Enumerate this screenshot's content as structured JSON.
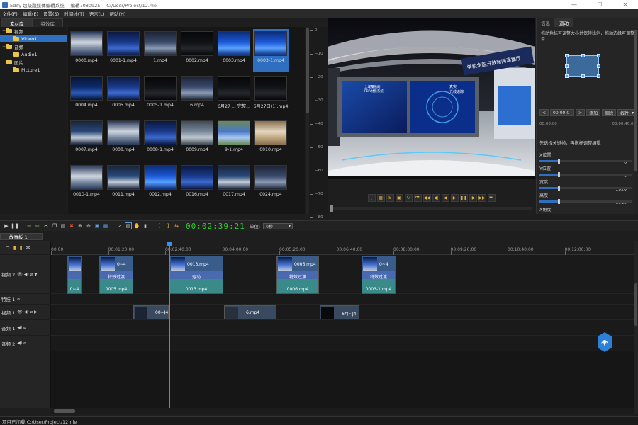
{
  "window": {
    "title": "Edify 超级融媒体编辑系统 -- 编辑7080925 -- C:/User/Project/12.nle"
  },
  "menu": [
    "文件(F)",
    "编辑(E)",
    "设置(S)",
    "时间线(T)",
    "语言(L)",
    "帮助(H)"
  ],
  "left_tabs": {
    "active": "素材库",
    "other": "特效库"
  },
  "tree": [
    {
      "label": "视频",
      "level": 0,
      "toggle": "−"
    },
    {
      "label": "Video1",
      "level": 1,
      "toggle": "",
      "selected": true
    },
    {
      "label": "音频",
      "level": 0,
      "toggle": "−"
    },
    {
      "label": "Audio1",
      "level": 1,
      "toggle": ""
    },
    {
      "label": "图片",
      "level": 0,
      "toggle": "−"
    },
    {
      "label": "Picture1",
      "level": 1,
      "toggle": ""
    }
  ],
  "media": [
    {
      "name": "0000.mp4",
      "scene": "lobby"
    },
    {
      "name": "0001-1.mp4",
      "scene": "studio"
    },
    {
      "name": "1.mp4",
      "scene": "room"
    },
    {
      "name": "0002.mp4",
      "scene": "dark"
    },
    {
      "name": "0003.mp4",
      "scene": "screen"
    },
    {
      "name": "0003-1.mp4",
      "scene": "screen",
      "selected": true
    },
    {
      "name": "0004.mp4",
      "scene": "blue"
    },
    {
      "name": "0005.mp4",
      "scene": "studio"
    },
    {
      "name": "0005-1.mp4",
      "scene": "dark"
    },
    {
      "name": "6.mp4",
      "scene": "room"
    },
    {
      "name": "6月27 ... 完整...",
      "scene": "dark"
    },
    {
      "name": "6月27日(1).mp4",
      "scene": "dark"
    },
    {
      "name": "0007.mp4",
      "scene": "hall"
    },
    {
      "name": "0008.mp4",
      "scene": "lobby"
    },
    {
      "name": "0008-1.mp4",
      "scene": "studio"
    },
    {
      "name": "0009.mp4",
      "scene": "outdoor"
    },
    {
      "name": "9-1.mp4",
      "scene": "sky"
    },
    {
      "name": "0010.mp4",
      "scene": "phone"
    },
    {
      "name": "0010-1.mp4",
      "scene": "lobby"
    },
    {
      "name": "0011.mp4",
      "scene": "hall"
    },
    {
      "name": "0012.mp4",
      "scene": "screen"
    },
    {
      "name": "0016.mp4",
      "scene": "studio"
    },
    {
      "name": "0017.mp4",
      "scene": "hall"
    },
    {
      "name": "0024.mp4",
      "scene": "room"
    }
  ],
  "meter_ticks": [
    "0",
    "−10",
    "−20",
    "−30",
    "−40",
    "−50",
    "−60",
    "−70",
    "−80"
  ],
  "preview": {
    "screen_left_line1": "全域覆盖的",
    "screen_left_line2": "PBR材质系统",
    "screen_right_line1": "真实",
    "screen_right_line2": "光线追踪",
    "banner": "学校全国开放新闻演播厅"
  },
  "props": {
    "tabs": [
      "信息",
      "运动"
    ],
    "active_tab": "运动",
    "hint": "拖动角标可调整大小并保持比例，拖动边缘可调整单",
    "timecode": "00:00:0",
    "add_label": "添加",
    "delete_label": "删除",
    "interp": "线性",
    "ruler_left": "00:00:00",
    "ruler_right": "00:00:40.00",
    "note": "先选择关键帧，再拖标调整编辑",
    "rows": [
      {
        "label": "X位置",
        "value": "0"
      },
      {
        "label": "Y位置",
        "value": "0"
      },
      {
        "label": "宽度",
        "value": "1920"
      },
      {
        "label": "高度",
        "value": "1080"
      },
      {
        "label": "X角度",
        "value": ""
      }
    ]
  },
  "toolbar": {
    "timecode": "00:02:39:21",
    "unit_label": "单位:",
    "unit_value": "0秒"
  },
  "sequence_tab": "故事板 1",
  "ruler_ticks": [
    "00:00",
    "00:01:20:00",
    "00:02:40:00",
    "00:04:00:00",
    "00:05:20:00",
    "00:06:40:00",
    "00:08:00:00",
    "00:09:20:00",
    "00:10:40:00",
    "00:12:00:00"
  ],
  "tracks": [
    {
      "label": "视频 2",
      "icons": "👁 ◀) ⌀ ▼"
    },
    {
      "label": "特技 1",
      "icons": "⌀"
    },
    {
      "label": "视频 1",
      "icons": "👁 ◀) ⌀ ▶"
    },
    {
      "label": "音频 1",
      "icons": "◀) ⌀"
    },
    {
      "label": "音频 2",
      "icons": "◀) ⌀"
    }
  ],
  "clips_v2": [
    {
      "name": "0~4",
      "trans": "",
      "bottom": "0~4"
    },
    {
      "name": "0~4",
      "trans": "特效过渡",
      "bottom": "0005.mp4"
    },
    {
      "name": "0013.mp4",
      "trans": "运动",
      "bottom": "0013.mp4"
    },
    {
      "name": "0006.mp4",
      "trans": "特效过渡",
      "bottom": "0006.mp4"
    },
    {
      "name": "0~4",
      "trans": "特效过渡",
      "bottom": "0003-1.mp4"
    }
  ],
  "clips_v1": [
    {
      "name": "00~J4"
    },
    {
      "name": "6.mp4"
    },
    {
      "name": "6月~J4"
    }
  ],
  "status": "项目已加载:C:/User/Project/12.nle",
  "colors": {
    "accent": "#2e6fbf",
    "timecode": "#2ccd2c",
    "playhead": "#3a8ff0"
  }
}
